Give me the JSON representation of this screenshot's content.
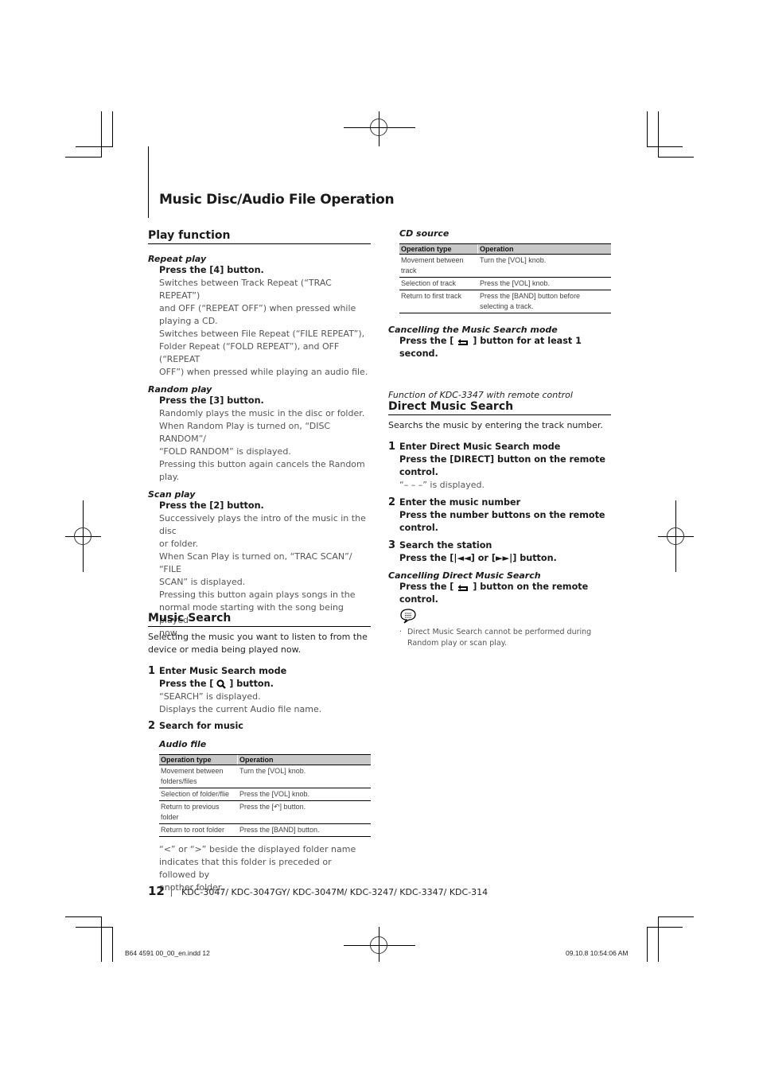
{
  "page_title": "Music Disc/Audio File Operation",
  "play_function": {
    "heading": "Play function",
    "repeat": {
      "title": "Repeat play",
      "instruction": "Press the [4] button.",
      "lines": [
        "Switches between Track Repeat (“TRAC REPEAT”)",
        "and OFF (“REPEAT OFF”) when pressed while",
        "playing a CD.",
        "Switches between File Repeat (“FILE REPEAT”),",
        "Folder Repeat (“FOLD REPEAT”), and OFF (“REPEAT",
        "OFF”) when pressed while playing an audio file."
      ]
    },
    "random": {
      "title": "Random play",
      "instruction": "Press the [3] button.",
      "lines": [
        "Randomly plays the music in the disc or folder.",
        "When Random Play is turned on, “DISC RANDOM”/",
        "“FOLD RANDOM” is displayed.",
        "Pressing this button again cancels the Random",
        "play."
      ]
    },
    "scan": {
      "title": "Scan play",
      "instruction": "Press the [2] button.",
      "lines": [
        "Successively plays the intro of the music in the disc",
        "or folder.",
        "When Scan Play is turned on, “TRAC SCAN”/ “FILE",
        "SCAN” is displayed.",
        "Pressing this button again plays songs in the",
        "normal mode starting with the song being played",
        "now."
      ]
    }
  },
  "music_search": {
    "heading": "Music Search",
    "intro": [
      "Selecting the music you want to listen to from the",
      "device or media being played now."
    ],
    "step1": {
      "num": "1",
      "title": "Enter Music Search mode",
      "instr_pre": "Press the [",
      "instr_post": "] button.",
      "lines": [
        "“SEARCH” is displayed.",
        "Displays the current Audio file name."
      ]
    },
    "step2": {
      "num": "2",
      "title": "Search for music"
    },
    "audio_file": {
      "title": "Audio file",
      "headers": [
        "Operation type",
        "Operation"
      ],
      "rows": [
        [
          "Movement between folders/files",
          "Turn the [VOL] knob."
        ],
        [
          "Selection of folder/flie",
          "Press the [VOL] knob."
        ],
        [
          "Return to previous folder",
          "Press the [↶] button."
        ],
        [
          "Return to root folder",
          "Press the [BAND] button."
        ]
      ]
    },
    "note": [
      "“<” or “>” beside the displayed folder name",
      "indicates that this folder is preceded or followed by",
      "another folder."
    ]
  },
  "cd_source": {
    "title": "CD source",
    "headers": [
      "Operation type",
      "Operation"
    ],
    "rows": [
      [
        "Movement between track",
        "Turn the [VOL] knob."
      ],
      [
        "Selection of track",
        "Press the [VOL] knob."
      ],
      [
        "Return to first track",
        "Press the [BAND] button before selecting a track."
      ]
    ],
    "cancel_title": "Cancelling the Music Search mode",
    "cancel_pre": "Press the [",
    "cancel_post": "] button for at least 1 second."
  },
  "direct_search": {
    "caption": "Function of KDC-3347 with remote control",
    "heading": "Direct Music Search",
    "intro": "Searchs the music by entering the track number.",
    "step1": {
      "num": "1",
      "title": "Enter Direct Music Search mode",
      "instr": [
        "Press the [DIRECT] button on the remote",
        "control."
      ],
      "note": "“– – –” is displayed."
    },
    "step2": {
      "num": "2",
      "title": "Enter the music number",
      "instr": [
        "Press the number buttons on the remote",
        "control."
      ]
    },
    "step3": {
      "num": "3",
      "title": "Search the station",
      "instr": "Press the [|◄◄] or [►►|] button."
    },
    "cancel_title": "Cancelling Direct Music Search",
    "cancel_pre": "Press the [",
    "cancel_post": "] button on the remote control.",
    "notes": [
      "Direct Music Search cannot be performed during",
      "Random play or scan play."
    ]
  },
  "footer": {
    "page_number": "12",
    "models": "KDC-3047/ KDC-3047GY/ KDC-3047M/ KDC-3247/ KDC-3347/ KDC-314",
    "file": "B64 4591 00_00_en.indd   12",
    "timestamp": "09.10.8   10:54:06 AM"
  }
}
